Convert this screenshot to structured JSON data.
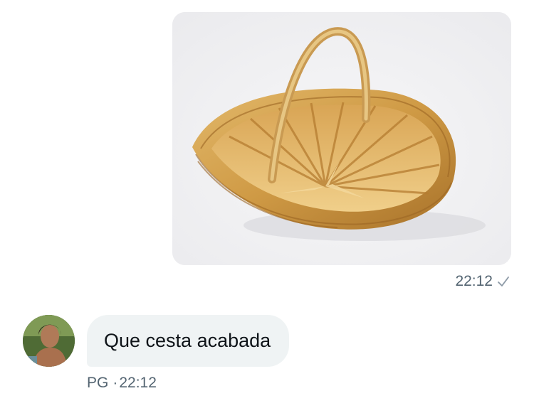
{
  "conversation": {
    "sent_message": {
      "image": "wicker-basket-photo",
      "time": "22:12",
      "status_icon": "checkmark-icon"
    },
    "received_message": {
      "avatar": "user-avatar",
      "text": "Que cesta acabada",
      "sender": "PG",
      "separator": "·",
      "time": "22:12"
    }
  },
  "colors": {
    "bubble_received": "#eff3f4",
    "meta_text": "#536471",
    "message_text": "#0f1419"
  }
}
